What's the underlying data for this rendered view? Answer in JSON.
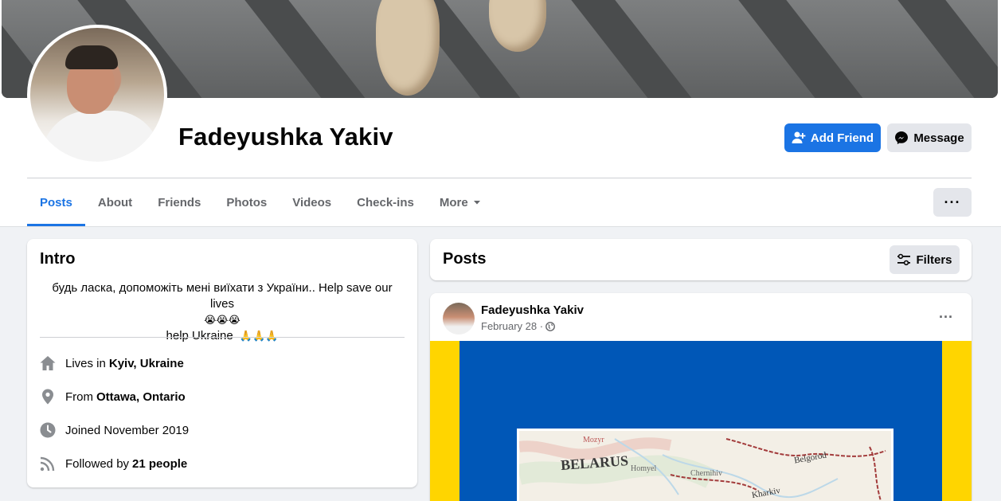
{
  "profile": {
    "name": "Fadeyushka Yakiv",
    "add_friend_label": "Add Friend",
    "message_label": "Message",
    "more_options_label": "···"
  },
  "tabs": [
    {
      "label": "Posts",
      "active": true
    },
    {
      "label": "About",
      "active": false
    },
    {
      "label": "Friends",
      "active": false
    },
    {
      "label": "Photos",
      "active": false
    },
    {
      "label": "Videos",
      "active": false
    },
    {
      "label": "Check-ins",
      "active": false
    },
    {
      "label": "More",
      "active": false
    }
  ],
  "intro": {
    "title": "Intro",
    "bio_line1": "будь ласка, допоможіть мені виїхати з України.. Help save our lives",
    "bio_emojis": "😭😭😭",
    "bio_line2": "help Ukraine",
    "bio_emojis2": "🙏🙏🙏",
    "details": [
      {
        "icon": "home-icon",
        "prefix": "Lives in",
        "value": "Kyiv, Ukraine"
      },
      {
        "icon": "location-pin-icon",
        "prefix": "From",
        "value": "Ottawa, Ontario"
      },
      {
        "icon": "clock-icon",
        "prefix": "Joined November 2019",
        "value": ""
      },
      {
        "icon": "rss-icon",
        "prefix": "Followed by",
        "value": "21 people"
      }
    ]
  },
  "posts_section": {
    "title": "Posts",
    "filters_label": "Filters"
  },
  "post": {
    "author": "Fadeyushka Yakiv",
    "date": "February 28 ·",
    "more_label": "···",
    "map_labels": {
      "belarus": "BELARUS",
      "belgorod": "Belgorod",
      "kharkiv": "Kharkiv",
      "homyel": "Homyel",
      "chernihiv": "Chernihiv",
      "mozyr": "Mozyr"
    }
  },
  "colors": {
    "accent": "#1b74e4",
    "ukraine_blue": "#0057b7",
    "ukraine_yellow": "#ffd500"
  }
}
